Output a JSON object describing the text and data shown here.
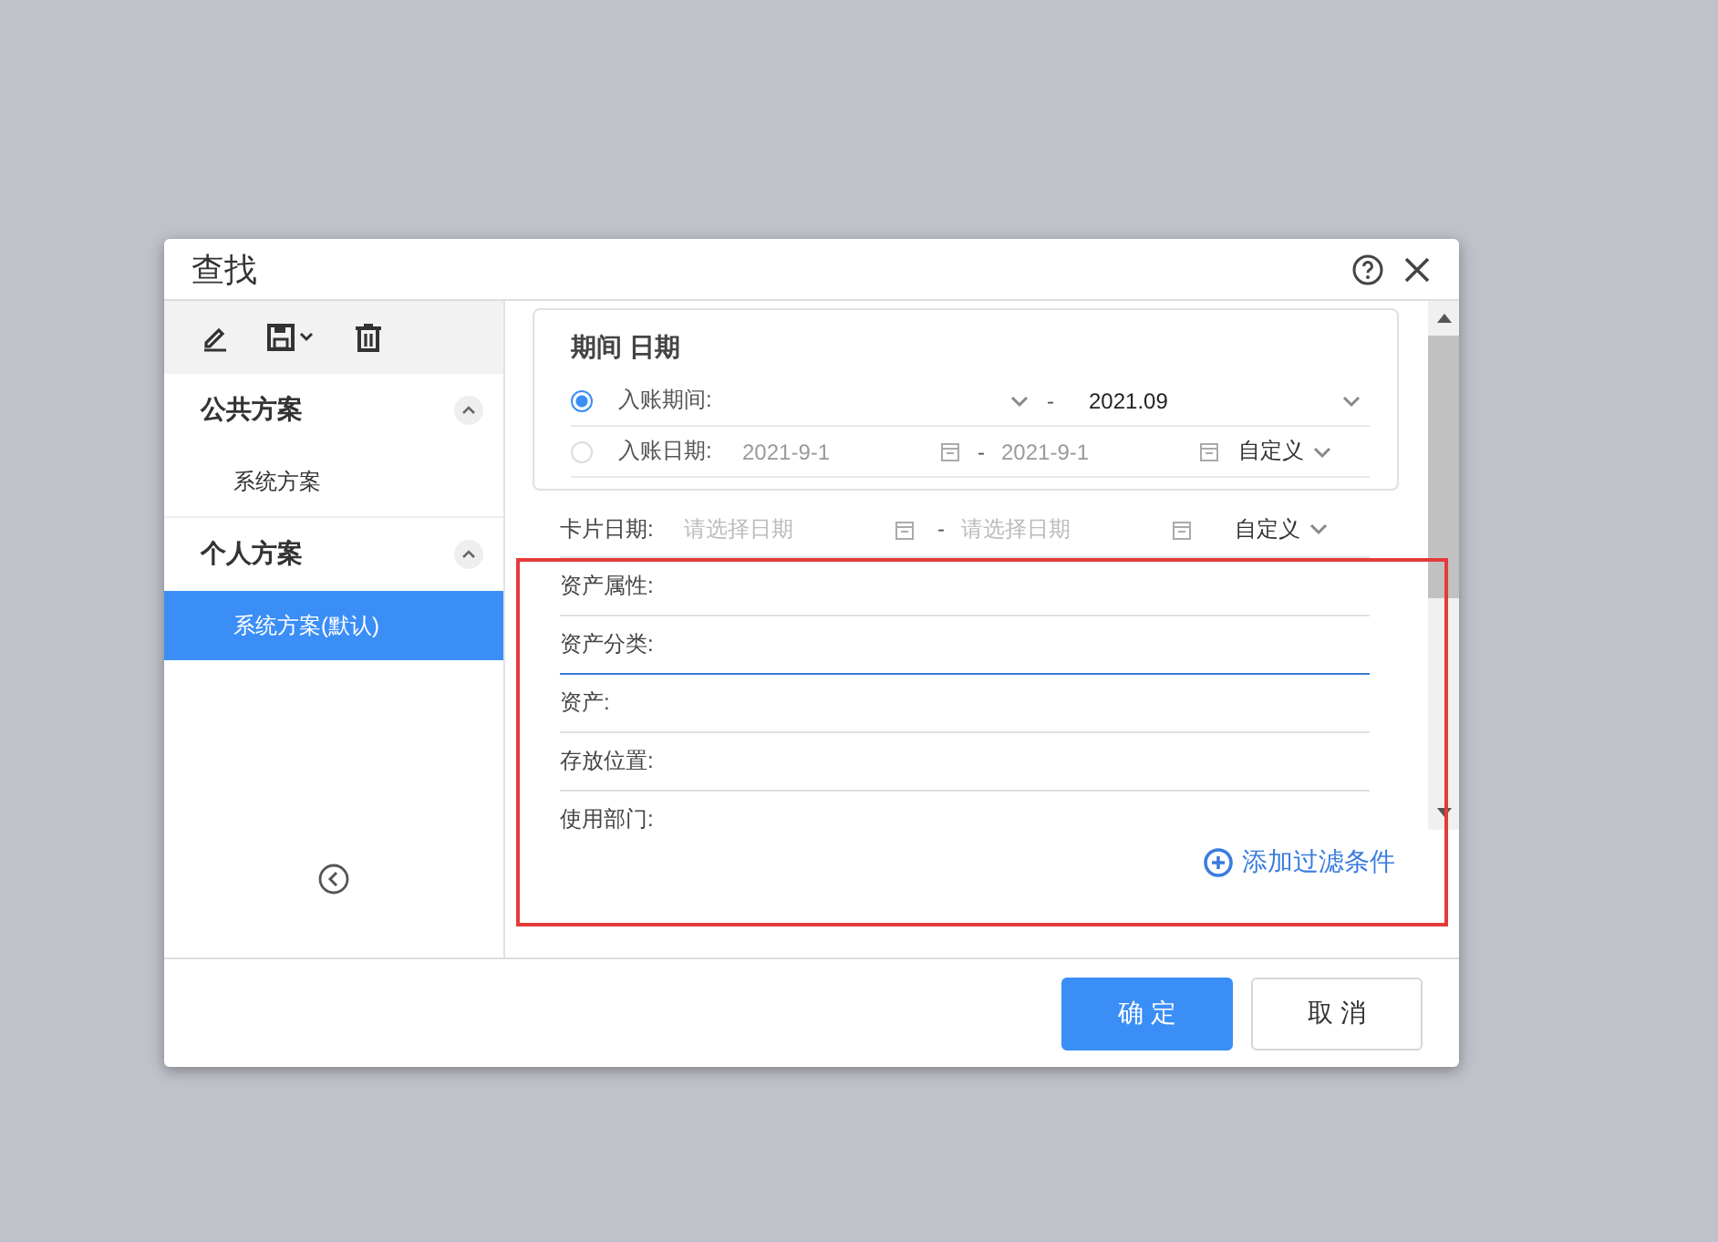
{
  "dialog": {
    "title": "查找"
  },
  "sidebar": {
    "groups": [
      {
        "title": "公共方案",
        "expanded": true,
        "items": [
          {
            "label": "系统方案",
            "selected": false
          }
        ]
      },
      {
        "title": "个人方案",
        "expanded": true,
        "items": [
          {
            "label": "系统方案(默认)",
            "selected": true
          }
        ]
      }
    ]
  },
  "period": {
    "title": "期间 日期",
    "options": [
      {
        "kind": "period",
        "label": "入账期间:",
        "selected": true,
        "separator": "-",
        "to": "2021.09"
      },
      {
        "kind": "date",
        "label": "入账日期:",
        "selected": false,
        "from": "2021-9-1",
        "separator": "-",
        "to": "2021-9-1",
        "range_type": "自定义"
      }
    ]
  },
  "card_date": {
    "label": "卡片日期:",
    "from_placeholder": "请选择日期",
    "separator": "-",
    "to_placeholder": "请选择日期",
    "range_type": "自定义"
  },
  "filters": [
    {
      "label": "资产属性:",
      "focused": false
    },
    {
      "label": "资产分类:",
      "focused": true
    },
    {
      "label": "资产:",
      "focused": false
    },
    {
      "label": "存放位置:",
      "focused": false
    },
    {
      "label": "使用部门:"
    }
  ],
  "add_filter": "添加过滤条件",
  "buttons": [
    {
      "label": "确 定",
      "kind": "primary"
    },
    {
      "label": "取 消",
      "kind": "default"
    }
  ],
  "annotation": {
    "kind": "rectangle"
  }
}
